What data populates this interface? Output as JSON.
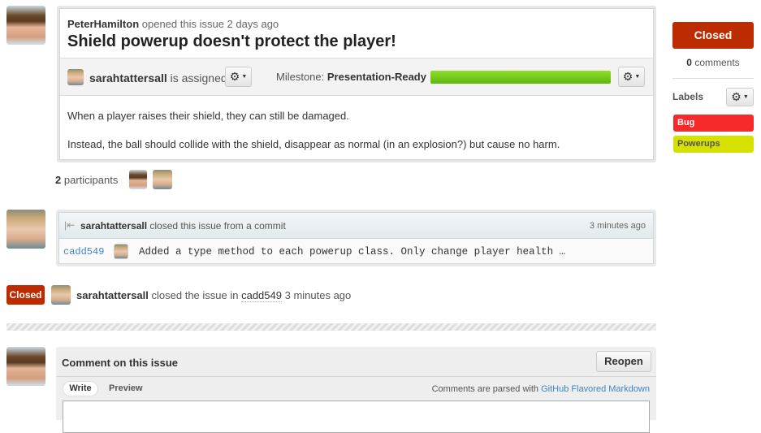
{
  "issue": {
    "author": "PeterHamilton",
    "opened_text": "opened this issue 2 days ago",
    "title": "Shield powerup doesn't protect the player!",
    "assignee": "sarahtattersall",
    "assigned_text": "is assigned",
    "milestone_label": "Milestone:",
    "milestone_name": "Presentation-Ready",
    "milestone_progress": 100,
    "body": [
      "When a player raises their shield, they can still be damaged.",
      "Instead, the ball should collide with the shield, disappear as normal (in an explosion?) but cause no harm."
    ]
  },
  "participants": {
    "count": "2",
    "label": "participants"
  },
  "commit_event": {
    "user": "sarahtattersall",
    "text": "closed this issue from a commit",
    "time": "3 minutes ago",
    "sha": "cadd549",
    "message": "Added a type method to each powerup class. Only change player health …"
  },
  "closed_event": {
    "badge": "Closed",
    "user": "sarahtattersall",
    "text": "closed the issue in",
    "sha": "cadd549",
    "time": "3 minutes ago"
  },
  "comment": {
    "title": "Comment on this issue",
    "reopen": "Reopen",
    "tab_write": "Write",
    "tab_preview": "Preview",
    "parsed_text": "Comments are parsed with",
    "markdown_link": "GitHub Flavored Markdown"
  },
  "sidebar": {
    "state": "Closed",
    "comments_count": "0",
    "comments_label": "comments",
    "labels_title": "Labels",
    "labels": [
      {
        "name": "Bug",
        "color": "#f62a2a"
      },
      {
        "name": "Powerups",
        "color": "#d6e100"
      }
    ]
  },
  "colors": {
    "closed": "#bd2c00",
    "milestone": "#6cc417"
  }
}
